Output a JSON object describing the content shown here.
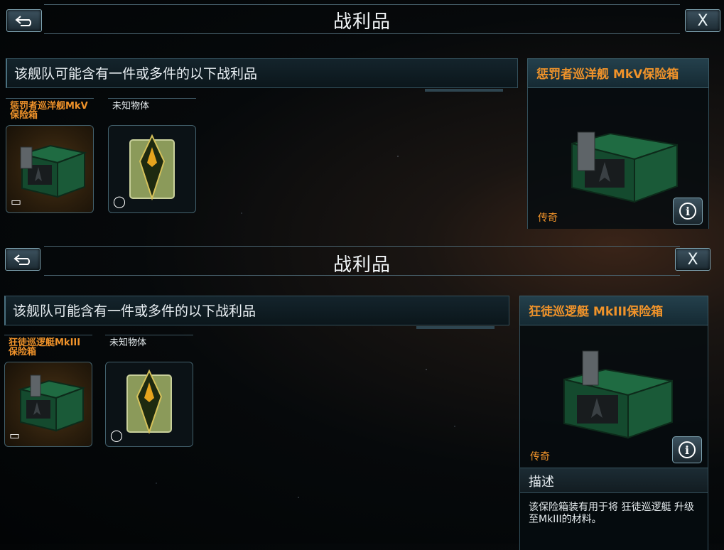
{
  "screens": [
    {
      "title": "战利品",
      "back_label": "⮌",
      "close_label": "X",
      "loot_heading": "该舰队可能含有一件或多件的以下战利品",
      "items": [
        {
          "label": "惩罚者巡洋舰MkV保险箱",
          "type": "vault",
          "corner_icon": "package-icon"
        },
        {
          "label": "未知物体",
          "type": "crystal",
          "corner_icon": "shield-icon"
        }
      ],
      "detail": {
        "title": "惩罚者巡洋舰 MkV保险箱",
        "rarity": "传奇",
        "info_icon": "i"
      }
    },
    {
      "title": "战利品",
      "back_label": "⮌",
      "close_label": "X",
      "loot_heading": "该舰队可能含有一件或多件的以下战利品",
      "items": [
        {
          "label": "狂徒巡逻艇MkIII保险箱",
          "type": "vault",
          "corner_icon": "package-icon"
        },
        {
          "label": "未知物体",
          "type": "crystal",
          "corner_icon": "shield-icon"
        }
      ],
      "detail": {
        "title": "狂徒巡逻艇 MkIII保险箱",
        "rarity": "传奇",
        "info_icon": "i",
        "description_title": "描述",
        "description_text": "该保险箱装有用于将 狂徒巡逻艇 升级至MkIII的材料。"
      }
    }
  ],
  "colors": {
    "accent_orange": "#f0932a",
    "frame": "#4a6470",
    "text": "#e8eef2"
  }
}
